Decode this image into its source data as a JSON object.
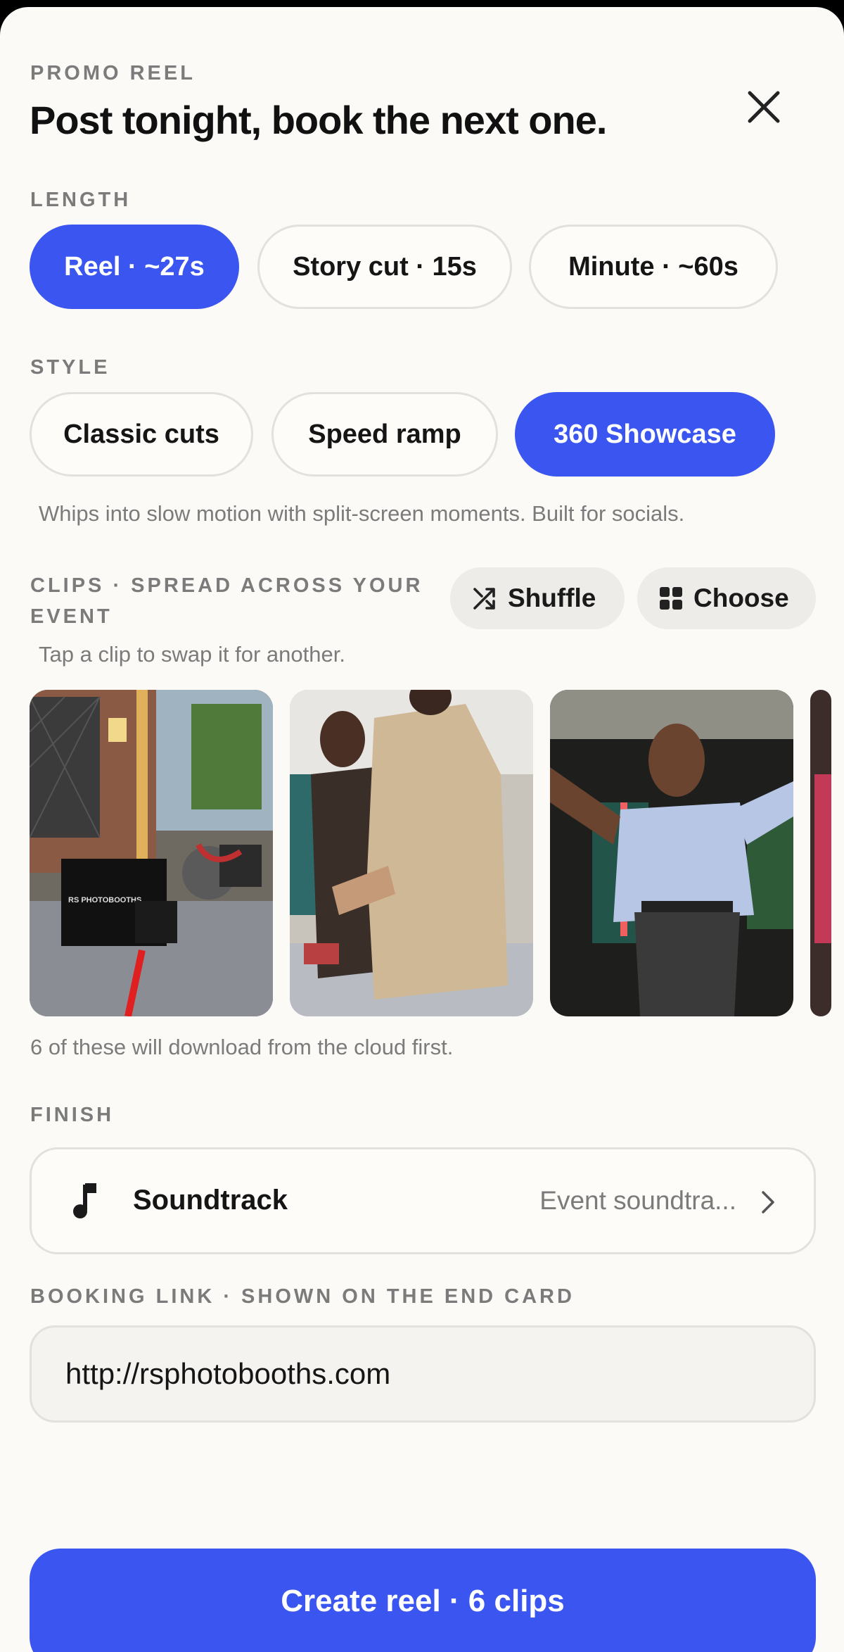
{
  "header": {
    "kicker": "PROMO REEL",
    "title": "Post tonight, book the next one.",
    "close_icon": "close-icon"
  },
  "length": {
    "label": "LENGTH",
    "options": [
      "Reel · ~27s",
      "Story cut · 15s",
      "Minute · ~60s"
    ],
    "selected": "Reel · ~27s"
  },
  "style": {
    "label": "STYLE",
    "options": [
      "Classic cuts",
      "Speed ramp",
      "360 Showcase"
    ],
    "selected": "360 Showcase",
    "description": "Whips into slow motion with split-screen moments. Built for socials."
  },
  "clips": {
    "label_line1": "CLIPS · SPREAD ACROSS YOUR",
    "label_line2": "EVENT",
    "shuffle_label": "Shuffle",
    "choose_label": "Choose",
    "hint": "Tap a clip to swap it for another.",
    "thumb_text": "RS PHOTOBOOTHS",
    "download_note": "6 of these will download from the cloud first."
  },
  "finish": {
    "label": "FINISH",
    "soundtrack_label": "Soundtrack",
    "soundtrack_value": "Event soundtra..."
  },
  "booking": {
    "label": "BOOKING LINK · SHOWN ON THE END CARD",
    "value": "http://rsphotobooths.com"
  },
  "cta": {
    "label": "Create reel · 6 clips"
  },
  "colors": {
    "accent": "#3b56f0",
    "background": "#fbfaf7",
    "muted_text": "#7b7b7b"
  }
}
